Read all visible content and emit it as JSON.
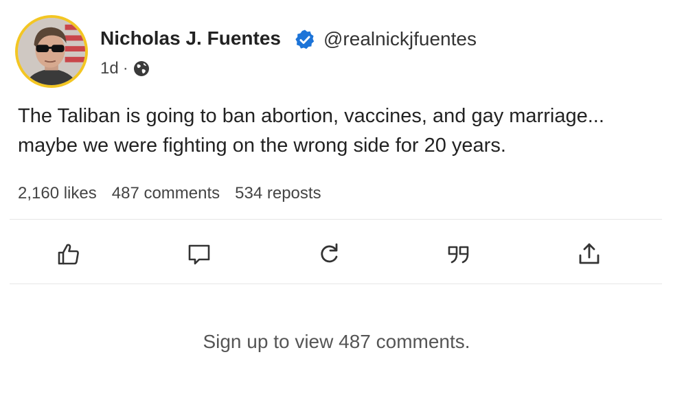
{
  "post": {
    "author": {
      "name": "Nicholas J. Fuentes",
      "handle": "@realnickjfuentes",
      "verified": true,
      "avatar_icon": "avatar-photo",
      "avatar_ring_color": "#f3c623"
    },
    "meta": {
      "time": "1d",
      "separator": "·",
      "visibility_icon": "globe-icon"
    },
    "text": {
      "line1": "The Taliban is going to ban abortion, vaccines, and gay marriage...",
      "line2": "maybe we were fighting on the wrong side for 20 years."
    },
    "stats": {
      "likes": "2,160 likes",
      "comments": "487 comments",
      "reposts": "534 reposts"
    },
    "actions": [
      {
        "name": "like",
        "icon": "thumbs-up-icon"
      },
      {
        "name": "comment",
        "icon": "comment-icon"
      },
      {
        "name": "repost",
        "icon": "repost-icon"
      },
      {
        "name": "quote",
        "icon": "quote-icon"
      },
      {
        "name": "share",
        "icon": "share-icon"
      }
    ],
    "signup_prompt": "Sign up to view 487 comments."
  },
  "colors": {
    "verified_badge": "#1d74d8",
    "text": "#222222",
    "muted": "#555555",
    "divider": "#e6e6e6"
  }
}
